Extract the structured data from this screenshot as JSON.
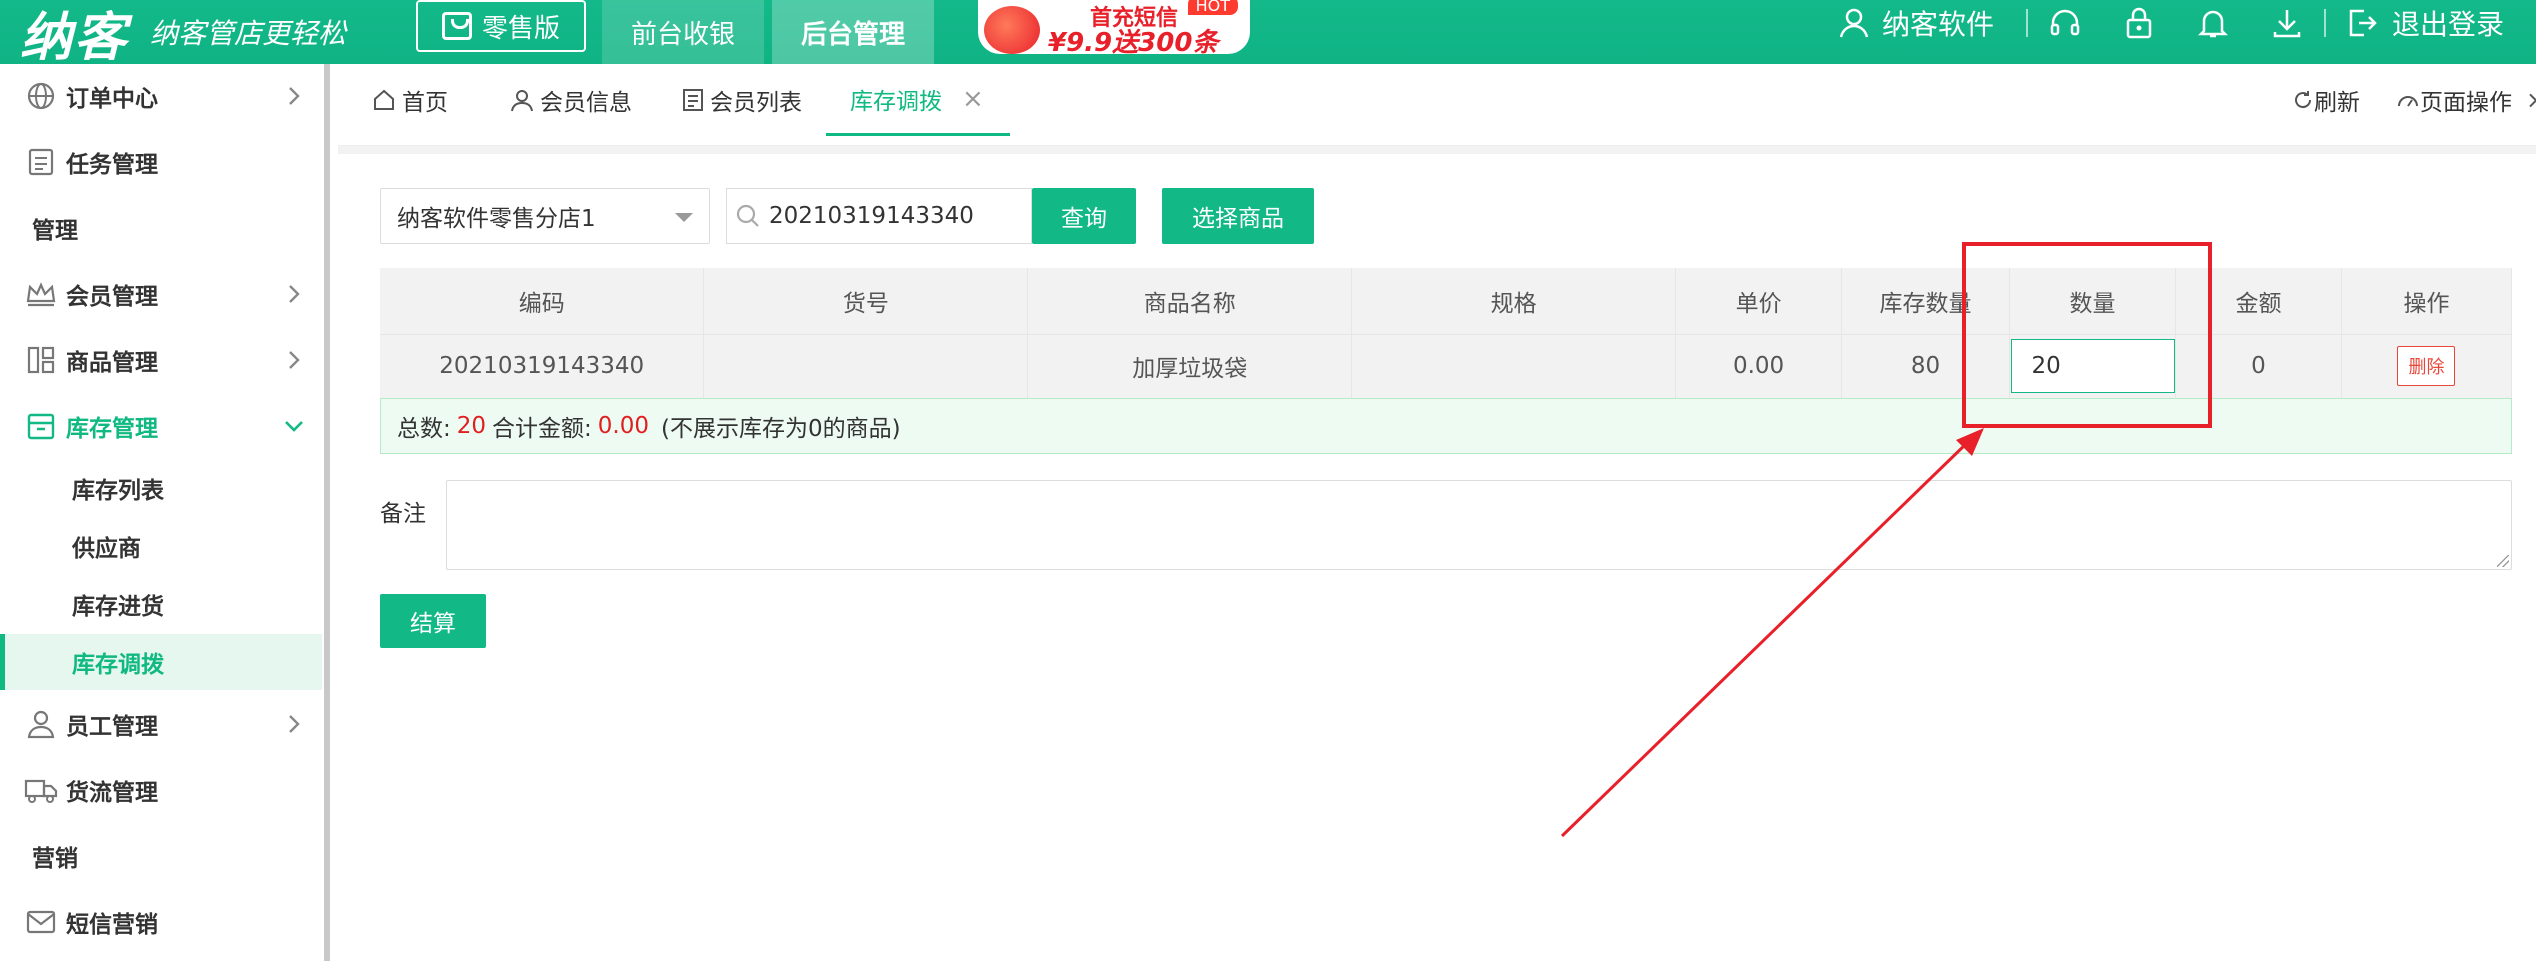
{
  "header": {
    "brand": "纳客",
    "slogan": "纳客管店更轻松",
    "edition": "零售版",
    "nav_tabs": [
      "前台收银",
      "后台管理"
    ],
    "banner": {
      "line1": "首充短信",
      "line2": "¥9.9送300条",
      "hot": "HOT"
    },
    "user_name": "纳客软件",
    "logout": "退出登录",
    "icons": [
      "headset-icon",
      "lock-icon",
      "bell-icon",
      "download-icon",
      "logout-icon"
    ]
  },
  "sidebar": {
    "items": [
      {
        "label": "订单中心",
        "icon": "globe-icon",
        "arrow": "right"
      },
      {
        "label": "任务管理",
        "icon": "clipboard-icon"
      },
      {
        "label": "管理"
      },
      {
        "label": "会员管理",
        "icon": "crown-icon",
        "arrow": "right"
      },
      {
        "label": "商品管理",
        "icon": "grid-icon",
        "arrow": "right"
      },
      {
        "label": "库存管理",
        "icon": "box-icon",
        "arrow": "down"
      },
      {
        "label": "员工管理",
        "icon": "person-icon",
        "arrow": "right"
      },
      {
        "label": "货流管理",
        "icon": "truck-icon"
      },
      {
        "label": "营销"
      },
      {
        "label": "短信营销",
        "icon": "mail-icon"
      }
    ],
    "sub_items": [
      "库存列表",
      "供应商",
      "库存进货",
      "库存调拨"
    ],
    "active_sub": "库存调拨"
  },
  "page_tabs": [
    {
      "label": "首页",
      "icon": "home-icon"
    },
    {
      "label": "会员信息",
      "icon": "user-icon"
    },
    {
      "label": "会员列表",
      "icon": "list-icon"
    },
    {
      "label": "库存调拨",
      "close": "×"
    }
  ],
  "page_ops": {
    "refresh": "刷新",
    "page_ops": "页面操作"
  },
  "filters": {
    "store_select": "纳客软件零售分店1",
    "search_value": "20210319143340",
    "query_btn": "查询",
    "choose_btn": "选择商品"
  },
  "table": {
    "columns": [
      "编码",
      "货号",
      "商品名称",
      "规格",
      "单价",
      "库存数量",
      "数量",
      "金额",
      "操作"
    ],
    "rows": [
      {
        "code": "20210319143340",
        "sku": "",
        "name": "加厚垃圾袋",
        "spec": "",
        "price": "0.00",
        "stock": "80",
        "qty": "20",
        "amount": "0",
        "action": "删除"
      }
    ]
  },
  "summary": {
    "total_label": "总数:",
    "total_value": "20",
    "amount_label": "合计金额:",
    "amount_value": "0.00",
    "note": "(不展示库存为0的商品)"
  },
  "remark_label": "备注",
  "settle_btn": "结算",
  "colors": {
    "accent": "#12b886",
    "annotation": "#e8202a"
  }
}
